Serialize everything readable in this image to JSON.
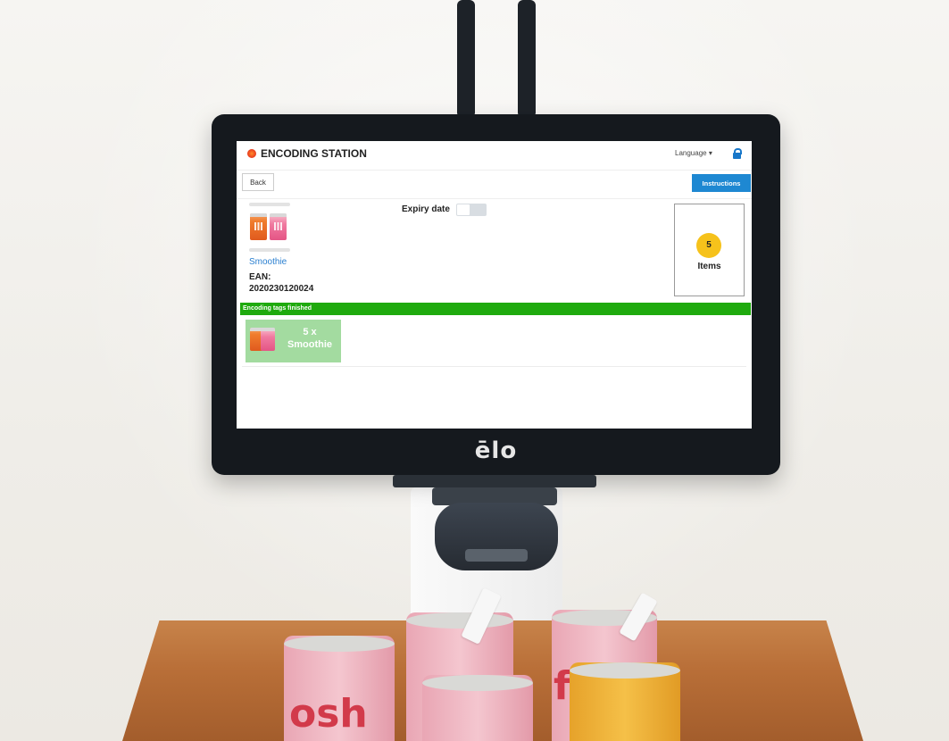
{
  "app": {
    "title": "ENCODING STATION",
    "language_label": "Language",
    "lock_icon": "lock-icon",
    "brand_color": "#e8391d",
    "accent_color": "#1e88d2"
  },
  "toolbar": {
    "back_label": "Back",
    "instructions_label": "Instructions"
  },
  "product": {
    "name": "Smoothie",
    "ean_label": "EAN:",
    "ean_value": "2020230120024"
  },
  "expiry": {
    "label": "Expiry date",
    "enabled": false
  },
  "items": {
    "count": "5",
    "label": "Items"
  },
  "status": {
    "text": "Encoding tags finished",
    "color": "#1faa0e"
  },
  "results": [
    {
      "qty": "5 x",
      "name": "Smoothie"
    }
  ],
  "device": {
    "brand": "ēlo"
  },
  "jar_labels": {
    "left": "osh",
    "right": "fre"
  }
}
